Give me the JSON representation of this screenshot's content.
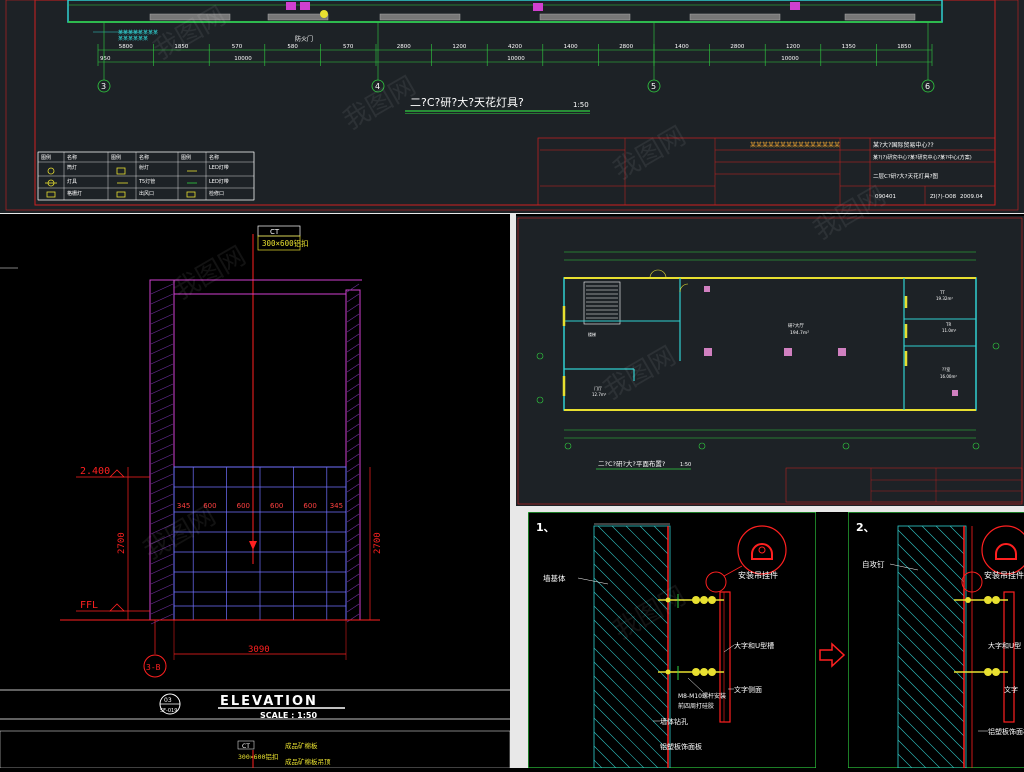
{
  "top_panel": {
    "dimensions_row1": [
      "5800",
      "1850",
      "570",
      "580",
      "570",
      "2800",
      "1200",
      "4200",
      "1400",
      "2800",
      "1400",
      "2800",
      "1200",
      "1350",
      "1850"
    ],
    "dimensions_row2": [
      "10000",
      "10000",
      "10000"
    ],
    "dimension_left": "950",
    "grid_axes": [
      "3",
      "4",
      "5",
      "6"
    ],
    "plan_title": "二?C?研?大?天花灯具?",
    "plan_scale": "1:50",
    "small_note": "防火门",
    "legend_rows": [
      [
        "图例",
        "名称",
        "图例",
        "名称",
        "图例",
        "名称"
      ],
      [
        "",
        "筒灯",
        "",
        "射灯",
        "",
        "LED灯带"
      ],
      [
        "",
        "灯具",
        "",
        "T5灯管",
        "",
        "LED灯带"
      ],
      [
        "",
        "格栅灯",
        "",
        "出风口",
        "",
        "检修口"
      ]
    ],
    "title_block": {
      "project": "某某某某某某某某某某某某某某某",
      "title_code": "某?大?国际贸易中心??",
      "subtitle": "某?(?)研究中心?某?研究中心?某?中心(方案)",
      "drawing_title": "二层C?研?大?天花灯具?图",
      "number": "090401",
      "sheet": "ZI(?)-O08",
      "date": "2009.04"
    }
  },
  "elevation": {
    "ct_label": "CT",
    "ct_spec": "300×600铝扣",
    "level_top": "2.400",
    "level_bottom": "FFL",
    "height_left": "2700",
    "height_right": "2700",
    "grid_dims": [
      "345",
      "600",
      "600",
      "600",
      "600",
      "345"
    ],
    "width_dim": "3090",
    "marker_code": "3-B",
    "section_code": "03",
    "section_ref": "SF-019",
    "title": "ELEVATION",
    "scale": "SCALE :  1:50",
    "bottom_ct": "CT",
    "bottom_spec": "300×600铝扣",
    "bottom_note1": "成品矿棉板",
    "bottom_note2": "成品矿棉板吊顶"
  },
  "floor_plan": {
    "room_main": "研?大厅",
    "room_main_area": "194.7m²",
    "room_right1": "TT",
    "room_right1_area": "19.32m²",
    "room_right2": "TR",
    "room_right2_area": "11.0m²",
    "room_right3": "??室",
    "room_right3_area": "16.00m²",
    "room_left": "门厅",
    "room_left_area": "12.7m²",
    "room_stair": "楼梯",
    "title": "二?C?研?大?平面布置?",
    "scale": "1:50"
  },
  "detail1": {
    "number": "1、",
    "label_wall": "墙基体",
    "label_hanger": "安装吊挂件",
    "label_uchannel": "大字和U型槽",
    "label_bolt": "M8-M10螺杆安装",
    "label_glue": "前四周打硅胶",
    "label_letter": "文字侧面",
    "label_drill": "墙体钻孔",
    "label_panel": "铝塑板饰面板"
  },
  "detail2": {
    "number": "2、",
    "label_screw": "自攻钉",
    "label_hanger": "安装吊挂件",
    "label_uchannel": "大字和U型",
    "label_letter": "文字",
    "label_panel": "铝塑板饰面板"
  },
  "watermark": "我图网",
  "colors": {
    "background": "#000000",
    "panel_bg": "#1d2226",
    "line_white": "#ffffff",
    "line_red": "#ff2020",
    "line_green": "#30d040",
    "line_yellow": "#e8e030",
    "line_cyan": "#30d0d0",
    "line_magenta": "#d040d0"
  }
}
